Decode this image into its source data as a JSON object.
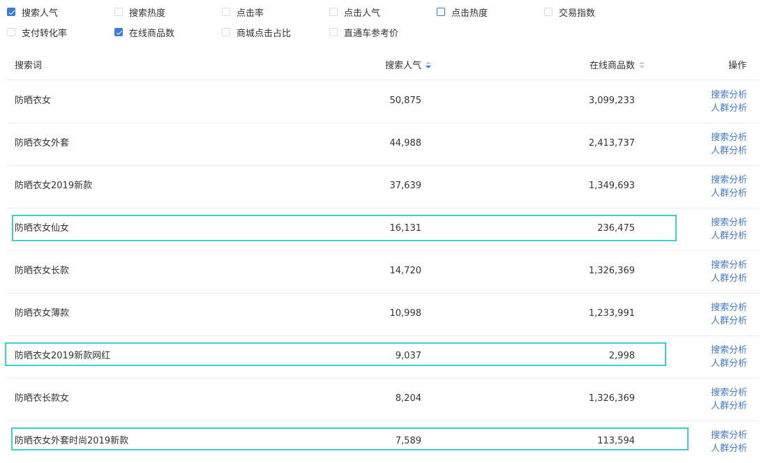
{
  "filters": [
    {
      "label": "搜索人气",
      "state": "checked"
    },
    {
      "label": "搜索热度",
      "state": "unchecked"
    },
    {
      "label": "点击率",
      "state": "unchecked"
    },
    {
      "label": "点击人气",
      "state": "unchecked"
    },
    {
      "label": "点击热度",
      "state": "outlined"
    },
    {
      "label": "交易指数",
      "state": "unchecked"
    },
    {
      "label": "支付转化率",
      "state": "unchecked"
    },
    {
      "label": "在线商品数",
      "state": "checked"
    },
    {
      "label": "商城点击占比",
      "state": "unchecked"
    },
    {
      "label": "直通车参考价",
      "state": "unchecked"
    }
  ],
  "table": {
    "headers": {
      "keyword": "搜索词",
      "popularity": "搜索人气",
      "goods": "在线商品数",
      "actions": "操作"
    },
    "rows": [
      {
        "keyword": "防晒衣女",
        "popularity": "50,875",
        "goods": "3,099,233",
        "highlighted": false
      },
      {
        "keyword": "防晒衣女外套",
        "popularity": "44,988",
        "goods": "2,413,737",
        "highlighted": false
      },
      {
        "keyword": "防晒衣女2019新款",
        "popularity": "37,639",
        "goods": "1,349,693",
        "highlighted": false
      },
      {
        "keyword": "防晒衣女仙女",
        "popularity": "16,131",
        "goods": "236,475",
        "highlighted": true
      },
      {
        "keyword": "防晒衣女长款",
        "popularity": "14,720",
        "goods": "1,326,369",
        "highlighted": false
      },
      {
        "keyword": "防晒衣女薄款",
        "popularity": "10,998",
        "goods": "1,233,991",
        "highlighted": false
      },
      {
        "keyword": "防晒衣女2019新款网红",
        "popularity": "9,037",
        "goods": "2,998",
        "highlighted": true
      },
      {
        "keyword": "防晒衣长款女",
        "popularity": "8,204",
        "goods": "1,326,369",
        "highlighted": false
      },
      {
        "keyword": "防晒衣女外套时尚2019新款",
        "popularity": "7,589",
        "goods": "113,594",
        "highlighted": true
      }
    ],
    "action_labels": {
      "search_analysis": "搜索分析",
      "crowd_analysis": "人群分析"
    }
  },
  "colors": {
    "accent": "#3f7ad8",
    "highlight_box": "#3bcfd2",
    "divider": "#ececec"
  },
  "sort_state": {
    "popularity": "descending",
    "goods": "none"
  }
}
